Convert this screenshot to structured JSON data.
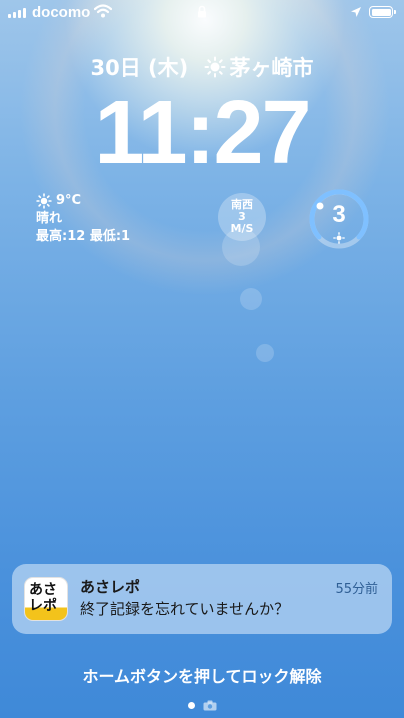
{
  "status": {
    "carrier": "docomo",
    "signal_bars": 4,
    "wifi": "wifi-icon",
    "lock": "lock-icon",
    "location": "location-arrow-icon",
    "battery": "battery-full-icon"
  },
  "lockscreen": {
    "date": "30日 (木)",
    "location": "茅ヶ崎市",
    "time": "11:27"
  },
  "widgets": {
    "weather": {
      "temp": "9°C",
      "condition": "晴れ",
      "range": "最高:12 最低:1"
    },
    "wind": {
      "direction": "南西",
      "speed": "3",
      "unit": "M/S"
    },
    "uv": {
      "value": "3"
    }
  },
  "notification": {
    "app_icon_text": "あさ\nレポ",
    "app_name": "あさレポ",
    "time": "55分前",
    "body": "終了記録を忘れていませんか？"
  },
  "footer": {
    "unlock_hint": "ホームボタンを押してロック解除"
  },
  "colors": {
    "notification_time": "#2f5f95",
    "uv_accent": "#7fc0ff"
  }
}
